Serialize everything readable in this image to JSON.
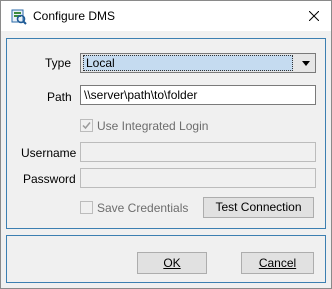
{
  "window": {
    "title": "Configure DMS",
    "icon": "dms-app-icon",
    "close_icon": "close-icon"
  },
  "form": {
    "type_label": "Type",
    "type_value": "Local",
    "path_label": "Path",
    "path_value": "\\\\server\\path\\to\\folder",
    "integrated_login_label": "Use Integrated Login",
    "integrated_login_checked": true,
    "username_label": "Username",
    "username_value": "",
    "password_label": "Password",
    "password_value": "",
    "save_credentials_label": "Save Credentials",
    "save_credentials_checked": false,
    "test_connection_label": "Test Connection"
  },
  "footer": {
    "ok_label": "OK",
    "cancel_label": "Cancel"
  },
  "colors": {
    "panel_border": "#3c7fb1",
    "selection": "#c5dbf0"
  }
}
